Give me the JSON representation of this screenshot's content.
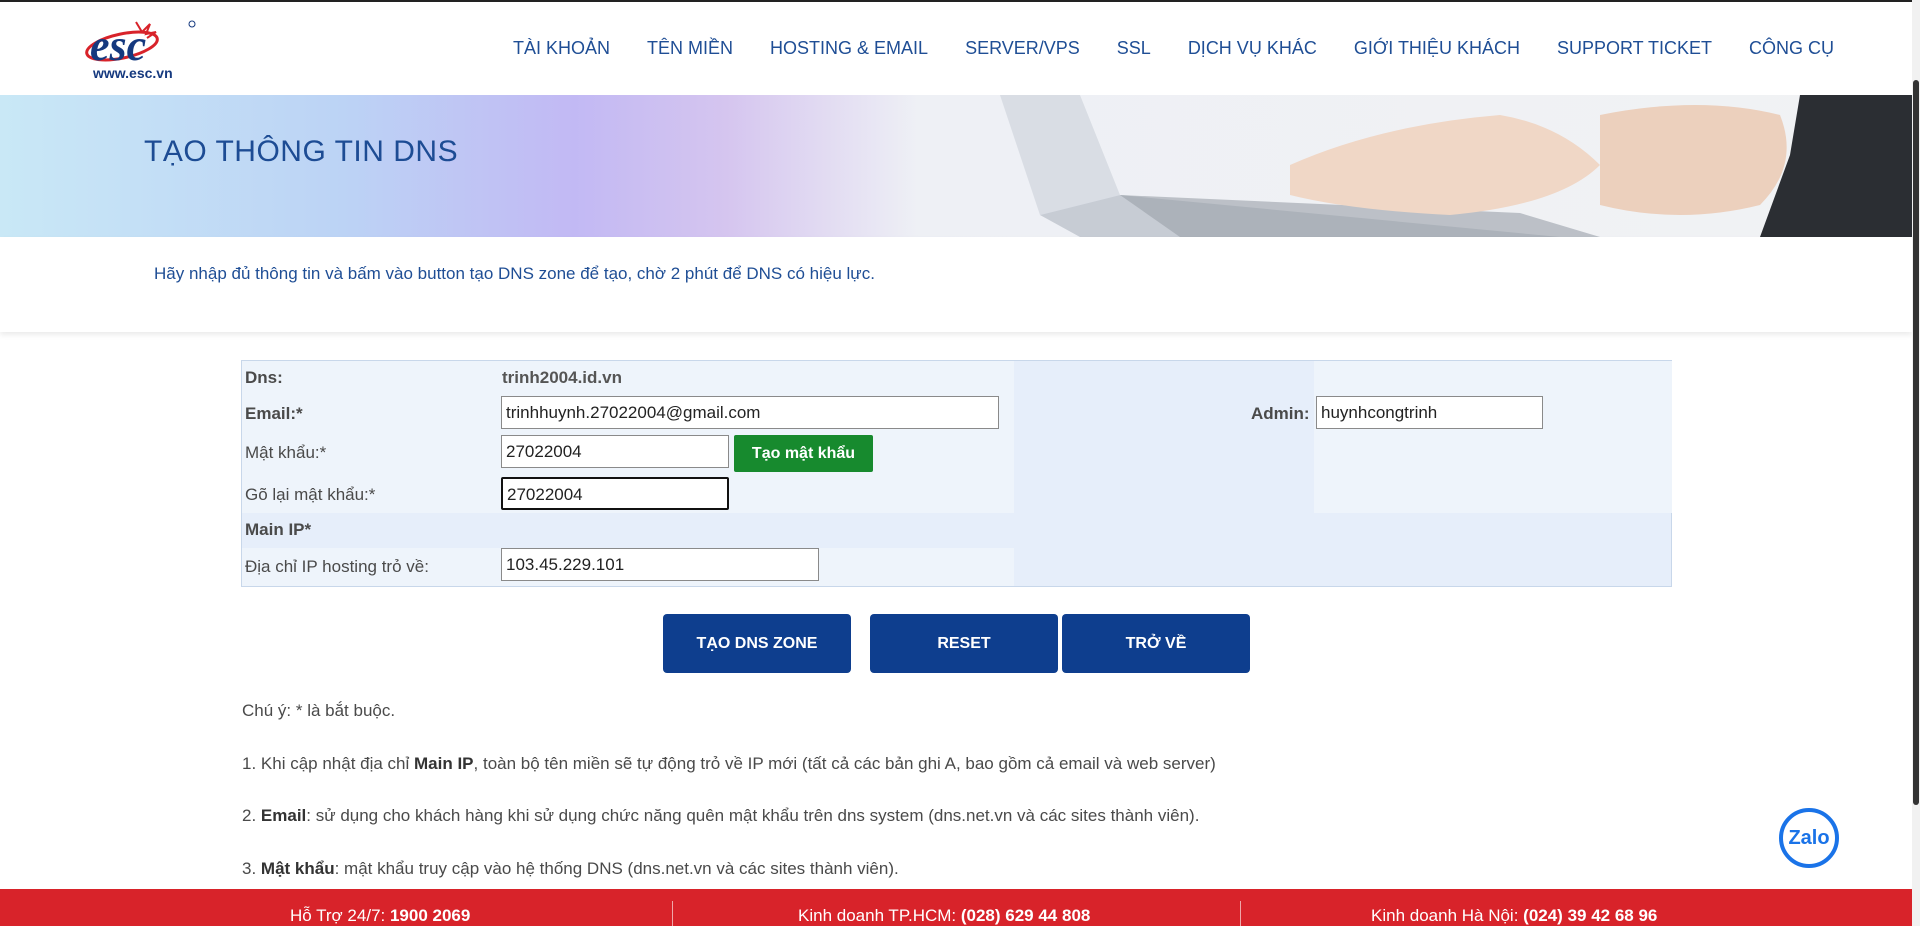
{
  "header": {
    "logo_text": "www.esc.vn",
    "nav": [
      "TÀI KHOẢN",
      "TÊN MIỀN",
      "HOSTING & EMAIL",
      "SERVER/VPS",
      "SSL",
      "DỊCH VỤ KHÁC",
      "GIỚI THIỆU KHÁCH",
      "SUPPORT TICKET",
      "CÔNG CỤ"
    ]
  },
  "banner": {
    "title": "TẠO THÔNG TIN DNS"
  },
  "notice": {
    "text": "Hãy nhập đủ thông tin và bấm vào button tạo DNS zone để tạo, chờ 2 phút để DNS có hiệu lực."
  },
  "form": {
    "dns_label": "Dns:",
    "dns_value": "trinh2004.id.vn",
    "email_label": "Email:*",
    "email_value": "trinhhuynh.27022004@gmail.com",
    "admin_label": "Admin:",
    "admin_value": "huynhcongtrinh",
    "password_label": "Mật khẩu:*",
    "password_value": "27022004",
    "generate_password_label": "Tạo mật khẩu",
    "repassword_label": "Gõ lại mật khẩu:*",
    "repassword_value": "27022004",
    "main_ip_label": "Main IP*",
    "ip_label": "Địa chỉ IP hosting trỏ về:",
    "ip_value": "103.45.229.101"
  },
  "actions": {
    "create_label": "TẠO DNS ZONE",
    "reset_label": "RESET",
    "back_label": "TRỞ VỀ"
  },
  "notes": {
    "intro": "Chú ý: * là bắt buộc.",
    "n1_prefix": "1. Khi cập nhật địa chỉ ",
    "n1_bold": "Main IP",
    "n1_suffix": ", toàn bộ tên miền sẽ tự động trỏ về IP mới (tất cả các bản ghi A, bao gồm cả email và web server)",
    "n2_prefix": "2. ",
    "n2_bold": "Email",
    "n2_suffix": ": sử dụng cho khách hàng khi sử dụng chức năng quên mật khẩu trên dns system (dns.net.vn và các sites thành viên).",
    "n3_prefix": "3. ",
    "n3_bold": "Mật khẩu",
    "n3_suffix": ": mật khẩu truy cập vào hệ thống DNS (dns.net.vn và các sites thành viên)."
  },
  "zalo": {
    "label": "Zalo"
  },
  "footer": {
    "support_label": "Hỗ Trợ 24/7: ",
    "support_phone": "1900 2069",
    "hcm_label": "Kinh doanh TP.HCM: ",
    "hcm_phone": "(028) 629 44 808",
    "hn_label": "Kinh doanh Hà Nội: ",
    "hn_phone": "(024) 39 42 68 96"
  },
  "colors": {
    "brand_blue": "#0e3e8e",
    "nav_blue": "#1f4e95",
    "green": "#178a2e",
    "footer_red": "#d8232a"
  }
}
